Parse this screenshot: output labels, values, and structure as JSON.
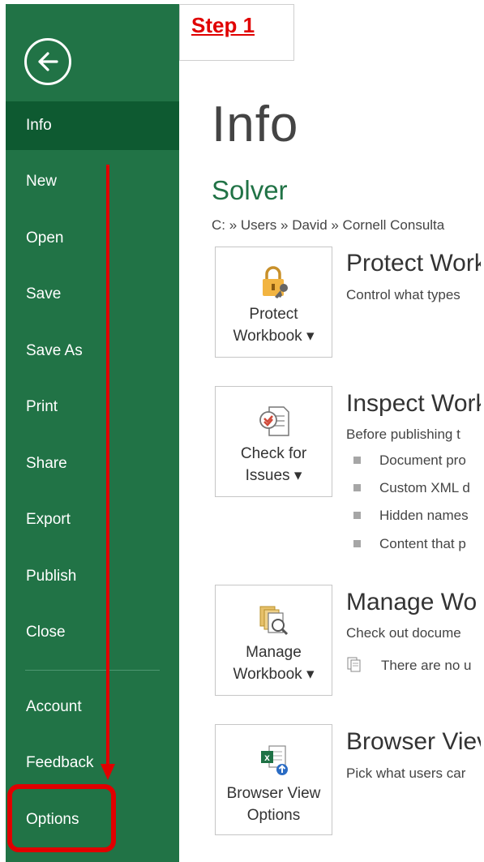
{
  "annotation": {
    "step_label": "Step 1"
  },
  "sidebar": {
    "back_icon": "back-arrow-circle-icon",
    "items": [
      {
        "label": "Info",
        "active": true
      },
      {
        "label": "New"
      },
      {
        "label": "Open"
      },
      {
        "label": "Save"
      },
      {
        "label": "Save As"
      },
      {
        "label": "Print"
      },
      {
        "label": "Share"
      },
      {
        "label": "Export"
      },
      {
        "label": "Publish"
      },
      {
        "label": "Close"
      },
      {
        "label": "Account"
      },
      {
        "label": "Feedback"
      },
      {
        "label": "Options"
      }
    ]
  },
  "main": {
    "title": "Info",
    "document_name": "Solver",
    "path": "C: » Users » David » Cornell Consulta",
    "sections": [
      {
        "button_line1": "Protect",
        "button_line2": "Workbook ▾",
        "icon": "lock-key-icon",
        "title": "Protect Work",
        "desc": "Control what types"
      },
      {
        "button_line1": "Check for",
        "button_line2": "Issues ▾",
        "icon": "inspect-document-icon",
        "title": "Inspect Work",
        "desc": "Before publishing t",
        "bullets": [
          "Document pro",
          "Custom XML d",
          "Hidden names",
          "Content that p"
        ]
      },
      {
        "button_line1": "Manage",
        "button_line2": "Workbook ▾",
        "icon": "manage-versions-icon",
        "title": "Manage Wo",
        "desc": "Check out docume",
        "note": "There are no u"
      },
      {
        "button_line1": "Browser View",
        "button_line2": "Options",
        "icon": "excel-browser-view-icon",
        "title": "Browser Viev",
        "desc": "Pick what users car"
      }
    ]
  },
  "colors": {
    "sidebar": "#217346",
    "sidebar_active": "#0e5a31",
    "accent_green": "#217346",
    "annotation_red": "#e00000"
  }
}
